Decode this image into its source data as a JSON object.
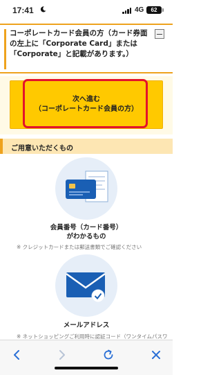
{
  "status": {
    "time": "17:41",
    "network": "4G",
    "battery": "62"
  },
  "header": {
    "text": "コーポレートカード会員の方（カード券面の左上に「Corporate Card」または「Corporate」と記載があります。）"
  },
  "next_button": {
    "line1": "次へ進む",
    "line2": "（コーポレートカード会員の方）"
  },
  "section": {
    "title": "ご用意いただくもの"
  },
  "items": [
    {
      "title_line1": "会員番号（カード番号）",
      "title_line2": "がわかるもの",
      "note": "※ クレジットカードまたは郵送書類でご確認ください"
    },
    {
      "title_line1": "メールアドレス",
      "note": "※ ネットショッピングご利用時に認証コード（ワンタイムパスワ"
    }
  ],
  "colors": {
    "accent_orange": "#eea21d",
    "button_yellow": "#ffc900",
    "highlight_red": "#e3122c",
    "icon_blue": "#1a5fb4"
  },
  "toolbar": {
    "icons": [
      "back-icon",
      "forward-icon",
      "reload-icon",
      "close-icon"
    ]
  }
}
